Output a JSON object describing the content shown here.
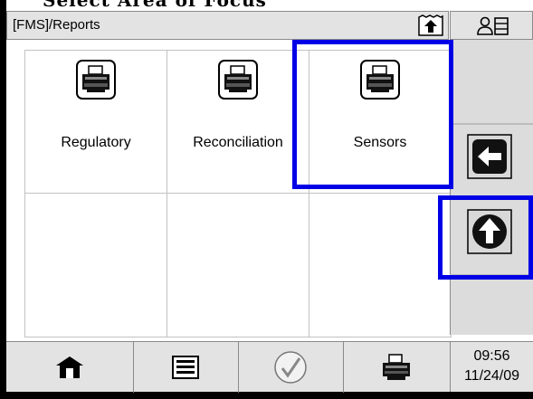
{
  "screen_heading_fragment": "Select Area of Focus",
  "header": {
    "title": "[FMS]/Reports"
  },
  "tiles": [
    {
      "label": "Regulatory"
    },
    {
      "label": "Reconciliation"
    },
    {
      "label": "Sensors"
    }
  ],
  "clock": {
    "time": "09:56",
    "date": "11/24/09"
  },
  "colors": {
    "highlight": "#0000e6",
    "bar": "#e3e3e3",
    "panel": "#dcdcdc"
  },
  "icons": {
    "tile": "printer-icon",
    "header": "upload-icon",
    "profile": "user-list-icon",
    "back": "back-arrow-icon",
    "up": "up-arrow-icon",
    "home": "home-icon",
    "list": "list-icon",
    "check": "checkmark-icon",
    "print": "printer-icon"
  }
}
